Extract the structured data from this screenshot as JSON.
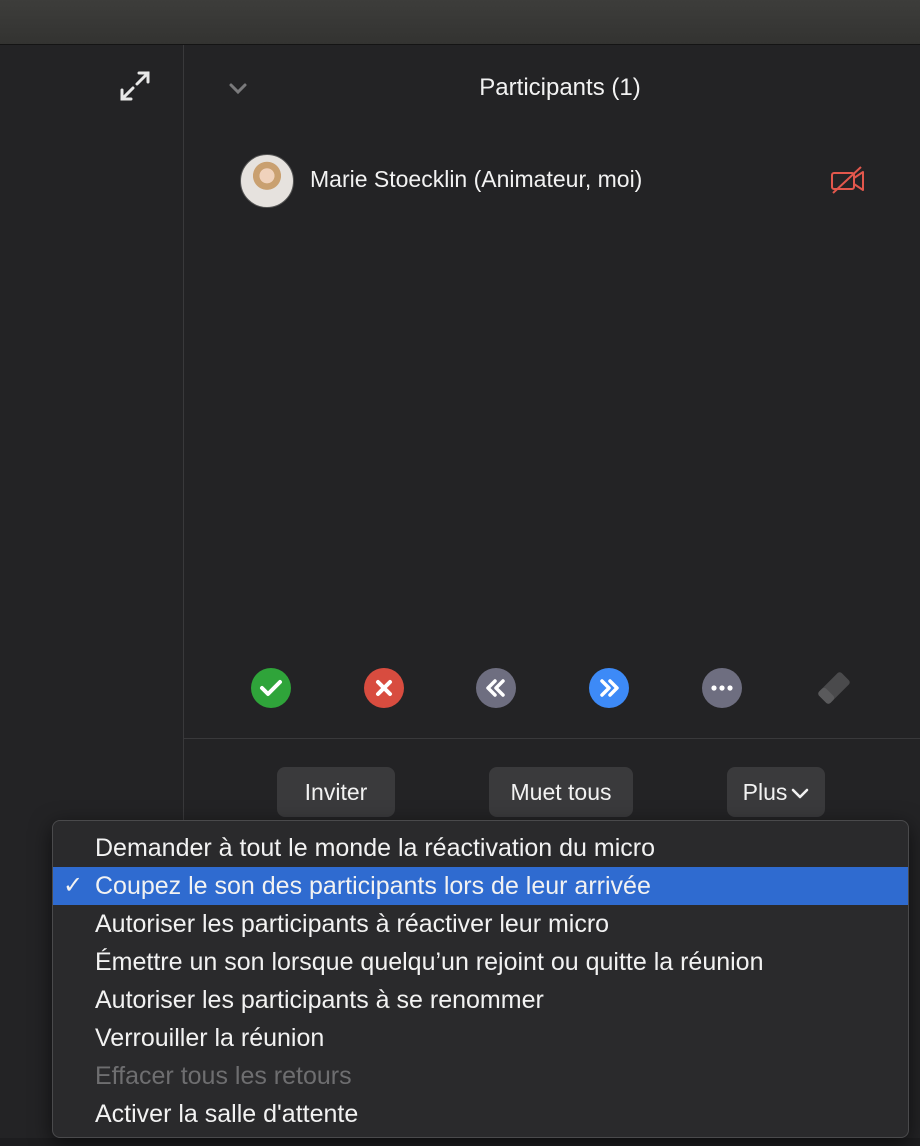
{
  "panel": {
    "title": "Participants (1)"
  },
  "participants": [
    {
      "name": "Marie Stoecklin (Animateur, moi)",
      "avatar": "avatar-photo",
      "video_status_icon": "video-off-icon"
    }
  ],
  "reactions": [
    {
      "icon": "yes-icon",
      "color": "#2fa43a"
    },
    {
      "icon": "no-icon",
      "color": "#d84c3f"
    },
    {
      "icon": "slower-icon",
      "color": "#6e6e80"
    },
    {
      "icon": "faster-icon",
      "color": "#3d8af7"
    },
    {
      "icon": "more-icon",
      "color": "#6e6e80"
    },
    {
      "icon": "clear-all-icon",
      "color": "#4a4a4c"
    }
  ],
  "actions": {
    "invite_label": "Inviter",
    "mute_all_label": "Muet tous",
    "more_label": "Plus"
  },
  "menu": {
    "items": [
      {
        "label": "Demander à tout le monde la réactivation du micro",
        "checked": false,
        "enabled": true
      },
      {
        "label": "Coupez le son des participants lors de leur arrivée",
        "checked": true,
        "enabled": true
      },
      {
        "label": "Autoriser les participants à réactiver leur micro",
        "checked": false,
        "enabled": true
      },
      {
        "label": "Émettre un son lorsque quelqu’un rejoint ou quitte la réunion",
        "checked": false,
        "enabled": true
      },
      {
        "label": "Autoriser les participants à se renommer",
        "checked": false,
        "enabled": true
      },
      {
        "label": "Verrouiller la réunion",
        "checked": false,
        "enabled": true
      },
      {
        "label": "Effacer tous les retours",
        "checked": false,
        "enabled": false
      },
      {
        "label": "Activer la salle d'attente",
        "checked": false,
        "enabled": true
      }
    ],
    "check_glyph": "✓",
    "highlight_color": "#2f6bd0"
  }
}
